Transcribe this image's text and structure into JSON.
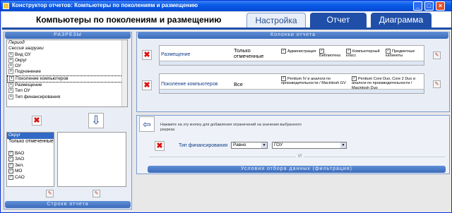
{
  "window": {
    "title": "Конструктор отчетов: Компьютеры по поколениям и размещению"
  },
  "header": {
    "title": "Компьютеры по поколениям и размещению"
  },
  "tabs": [
    {
      "label": "Настройка"
    },
    {
      "label": "Отчет"
    },
    {
      "label": "Диаграмма"
    }
  ],
  "left": {
    "sections_title": "РАЗРЕЗЫ",
    "tree": [
      {
        "label": "Период",
        "italic": true
      },
      {
        "label": "Сессия загрузки",
        "italic": true
      },
      {
        "label": "Вид ОУ"
      },
      {
        "label": "Округ"
      },
      {
        "label": "ОУ"
      },
      {
        "label": "Подчинение"
      },
      {
        "label": "Поколение компьютеров"
      },
      {
        "label": "Размещение"
      },
      {
        "label": "Тип ОУ"
      },
      {
        "label": "Тип финансирования"
      }
    ],
    "row_list_title": "Округ",
    "row_list_mode": "Только отмеченные",
    "row_list_items": [
      "ВАО",
      "ЗАО",
      "Зел.",
      "МО",
      "САО"
    ],
    "rows_title": "Строки отчета"
  },
  "columns": {
    "title": "Колонки отчета",
    "rows": [
      {
        "name": "Размещение",
        "mode": "Только отмеченные",
        "options": [
          "Администрация",
          "Библиотека",
          "Компьютерный класс",
          "Предметные кабинеты"
        ]
      },
      {
        "name": "Поколение компьютеров",
        "mode": "Все",
        "options": [
          "Pentium IV и аналоги по производительности / Macintosh GV",
          "Pentium Core Duo, Core 2 Duo и аналоги по производительности / Macintosh Duo"
        ]
      }
    ]
  },
  "filters": {
    "hint": "Нажмите на эту кнопку для добавления ограничений на значения выбранного разреза",
    "field": "Тип финансирования",
    "operator": "Равно",
    "value": "ГОУ",
    "and_label": "И",
    "title": "Условия отбора данных (фильтрация)"
  }
}
